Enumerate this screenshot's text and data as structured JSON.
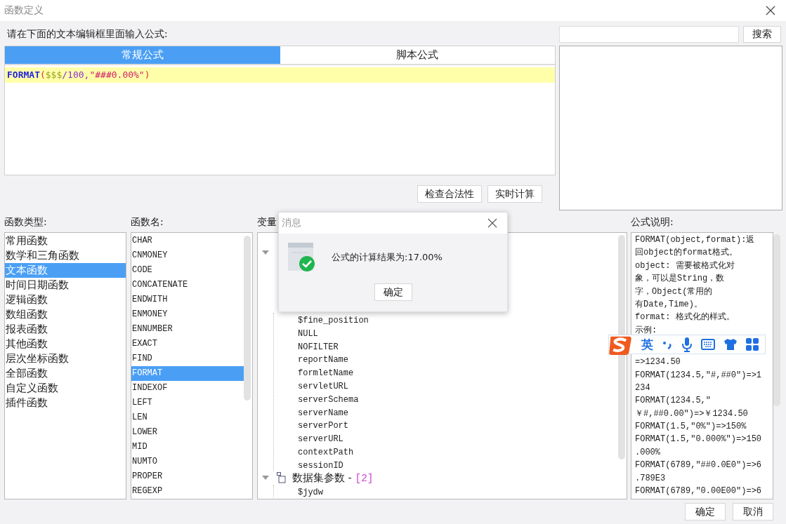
{
  "window": {
    "title": "函数定义"
  },
  "prompt": "请在下面的文本编辑框里面输入公式:",
  "formula_tabs": [
    {
      "label": "常规公式",
      "selected": true
    },
    {
      "label": "脚本公式",
      "selected": false
    }
  ],
  "formula": [
    {
      "kind": "function",
      "text": "FORMAT"
    },
    {
      "kind": "bracket",
      "text": "("
    },
    {
      "kind": "variable",
      "text": "$$$"
    },
    {
      "kind": "operator",
      "text": "/100,"
    },
    {
      "kind": "string",
      "text": "\"###0.00%\""
    },
    {
      "kind": "bracket",
      "text": ")"
    }
  ],
  "formula_buttons": [
    "检查合法性",
    "实时计算"
  ],
  "search": {
    "button": "搜索"
  },
  "function_types": {
    "label": "函数类型:",
    "items": [
      {
        "label": "常用函数",
        "selected": false
      },
      {
        "label": "数学和三角函数",
        "selected": false
      },
      {
        "label": "文本函数",
        "selected": true
      },
      {
        "label": "时间日期函数",
        "selected": false
      },
      {
        "label": "逻辑函数",
        "selected": false
      },
      {
        "label": "数组函数",
        "selected": false
      },
      {
        "label": "报表函数",
        "selected": false
      },
      {
        "label": "其他函数",
        "selected": false
      },
      {
        "label": "层次坐标函数",
        "selected": false
      },
      {
        "label": "全部函数",
        "selected": false
      },
      {
        "label": "自定义函数",
        "selected": false
      },
      {
        "label": "插件函数",
        "selected": false
      }
    ]
  },
  "function_names": {
    "label": "函数名:",
    "items": [
      {
        "label": "CHAR",
        "selected": false
      },
      {
        "label": "CNMONEY",
        "selected": false
      },
      {
        "label": "CODE",
        "selected": false
      },
      {
        "label": "CONCATENATE",
        "selected": false
      },
      {
        "label": "ENDWITH",
        "selected": false
      },
      {
        "label": "ENMONEY",
        "selected": false
      },
      {
        "label": "ENNUMBER",
        "selected": false
      },
      {
        "label": "EXACT",
        "selected": false
      },
      {
        "label": "FIND",
        "selected": false
      },
      {
        "label": "FORMAT",
        "selected": true
      },
      {
        "label": "INDEXOF",
        "selected": false
      },
      {
        "label": "LEFT",
        "selected": false
      },
      {
        "label": "LEN",
        "selected": false
      },
      {
        "label": "LOWER",
        "selected": false
      },
      {
        "label": "MID",
        "selected": false
      },
      {
        "label": "NUMTO",
        "selected": false
      },
      {
        "label": "PROPER",
        "selected": false
      },
      {
        "label": "REGEXP",
        "selected": false
      }
    ]
  },
  "variables": {
    "label": "变量",
    "tree": [
      {
        "expanded": true,
        "children": [
          {
            "label": "$fine_position"
          },
          {
            "label": "NULL"
          },
          {
            "label": "NOFILTER"
          },
          {
            "label": "reportName"
          },
          {
            "label": "formletName"
          },
          {
            "label": "servletURL"
          },
          {
            "label": "serverSchema"
          },
          {
            "label": "serverName"
          },
          {
            "label": "serverPort"
          },
          {
            "label": "serverURL"
          },
          {
            "label": "contextPath"
          },
          {
            "label": "sessionID"
          }
        ]
      },
      {
        "label": "数据集参数 - ",
        "count": "[2]",
        "expanded": true,
        "children": [
          {
            "label": "$jydw"
          }
        ]
      }
    ]
  },
  "description": {
    "label": "公式说明:",
    "lines_above": [
      "FORMAT(object,format):返",
      "回object的format格式。",
      "object: 需要被格式化对",
      "象，可以是String，数",
      "字，Object(常用的",
      "有Date,Time)。",
      "format: 格式化的样式。",
      "示例:"
    ],
    "lines_below": [
      "=>1234.50",
      "FORMAT(1234.5,\"#,##0\")=>1",
      "234",
      "FORMAT(1234.5,\"",
      "￥#,##0.00\")=>￥1234.50",
      "FORMAT(1.5,\"0%\")=>150%",
      "FORMAT(1.5,\"0.000%\")=>150",
      ".000%",
      "FORMAT(6789,\"##0.0E0\")=>6",
      ".789E3",
      "FORMAT(6789,\"0.00E00\")=>6"
    ]
  },
  "dialog_buttons": [
    "确定",
    "取消"
  ],
  "message": {
    "title": "消息",
    "text": "公式的计算结果为:17.00%",
    "button": "确定"
  },
  "ime_toolbar": {
    "mode": "英"
  }
}
